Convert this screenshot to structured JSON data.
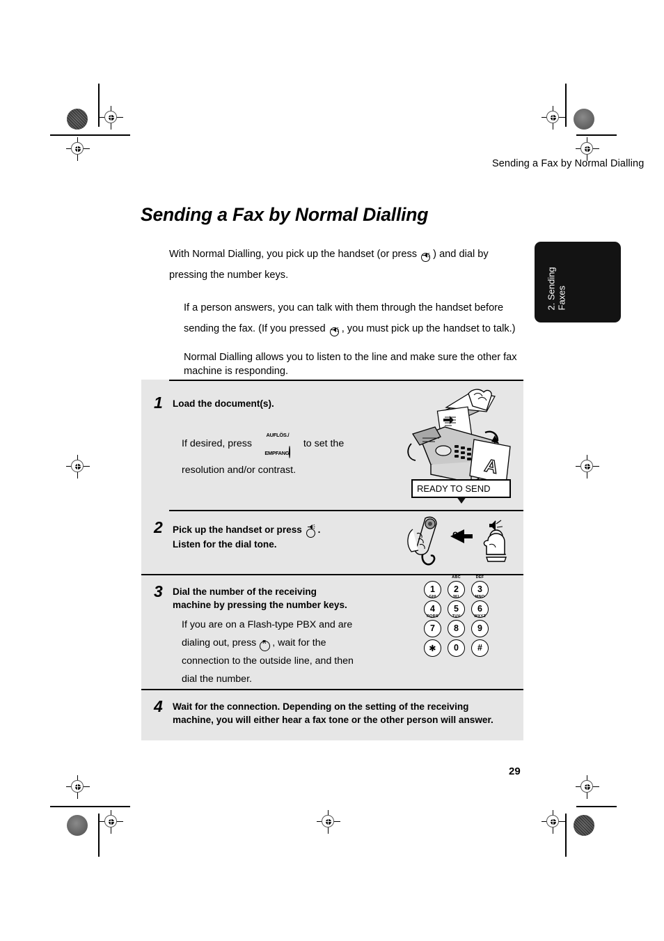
{
  "running_head": "Sending a Fax by Normal Dialling",
  "heading": "Sending a Fax by Normal Dialling",
  "page_number": "29",
  "side_tab": {
    "label": "2. Sending\nFaxes"
  },
  "intro": {
    "para1_a": "With Normal Dialling, you pick up the handset (or press",
    "para1_b": ") and dial by",
    "para1_c": "pressing the number keys.",
    "para2_a": "If a person answers, you can talk with them through the handset before",
    "para2_b": "sending the fax. (If you pressed",
    "para2_c": ", you must pick up the handset to talk.)",
    "para3": "Normal Dialling allows you to listen to the line and make sure the other fax machine is responding."
  },
  "steps": [
    {
      "number": "1",
      "title": "Load the document(s).",
      "body_a": "If desired, press",
      "button_label_line1": "AUFLÖS./",
      "button_label_line2": "EMPFANG",
      "body_b": "to set the",
      "body_c": "resolution and/or contrast.",
      "display_text": "READY TO SEND"
    },
    {
      "number": "2",
      "title_a": "Pick up the handset or press",
      "title_b": ".",
      "title_line2": "Listen for the dial tone.",
      "or_label": "or"
    },
    {
      "number": "3",
      "title_line1": "Dial the number of the receiving",
      "title_line2": "machine by pressing the number keys.",
      "body_a": "If you are on a Flash-type PBX and are",
      "body_b": "dialing out, press",
      "flash_key_label": "R",
      "body_c": ", wait for the",
      "body_d": "connection to the outside line, and then",
      "body_e": "dial the number."
    },
    {
      "number": "4",
      "title_line1": "Wait for the connection. Depending on the setting of the receiving",
      "title_line2": "machine, you will either hear a fax tone or the other person will answer."
    }
  ],
  "keypad": {
    "rows": [
      [
        {
          "digit": "1",
          "letters": ""
        },
        {
          "digit": "2",
          "letters": "ABC"
        },
        {
          "digit": "3",
          "letters": "DEF"
        }
      ],
      [
        {
          "digit": "4",
          "letters": "GHI"
        },
        {
          "digit": "5",
          "letters": "JKL"
        },
        {
          "digit": "6",
          "letters": "MNO"
        }
      ],
      [
        {
          "digit": "7",
          "letters": "PQRS"
        },
        {
          "digit": "8",
          "letters": "TUV"
        },
        {
          "digit": "9",
          "letters": "WXYZ"
        }
      ],
      [
        {
          "digit": "✱",
          "letters": ""
        },
        {
          "digit": "0",
          "letters": ""
        },
        {
          "digit": "#",
          "letters": ""
        }
      ]
    ]
  },
  "colors": {
    "tab_bg": "#131313",
    "box_bg": "#e6e6e6",
    "page_bg": "#ffffff"
  }
}
